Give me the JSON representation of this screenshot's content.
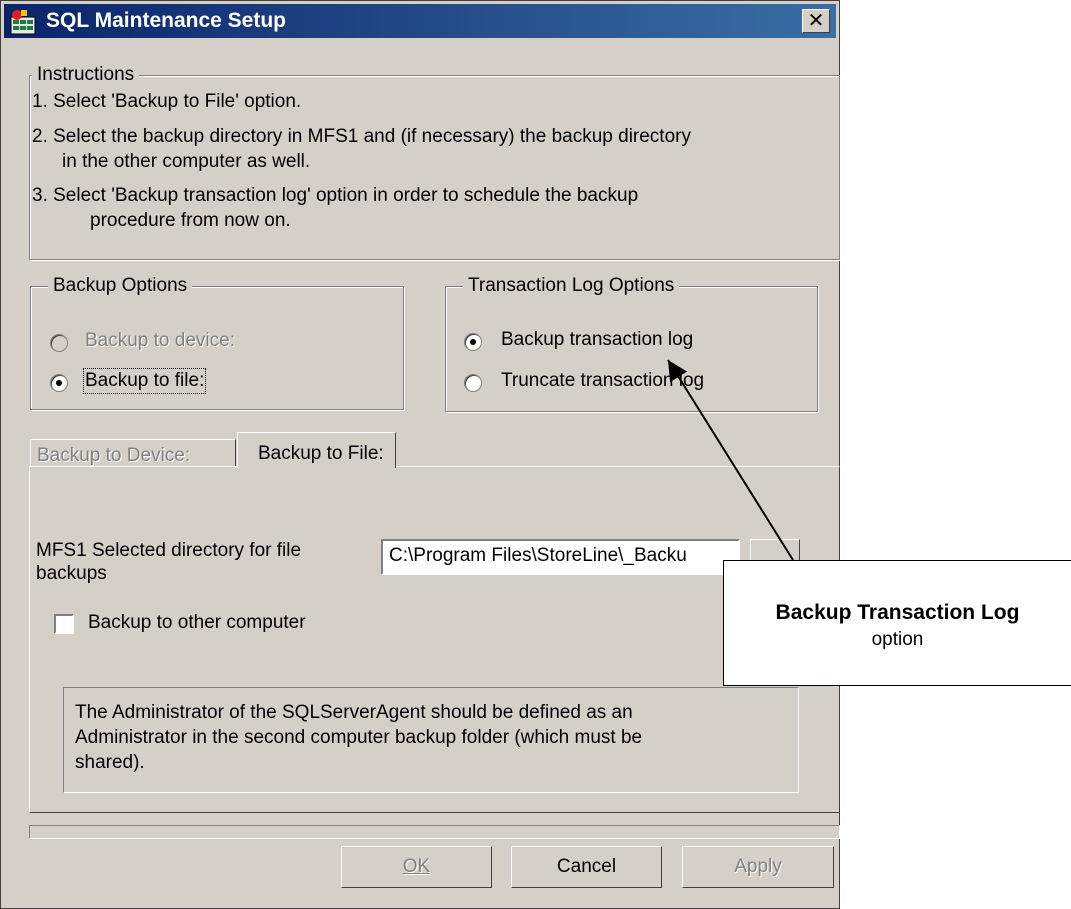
{
  "window": {
    "title": "SQL Maintenance Setup",
    "close_label": "✕"
  },
  "instructions": {
    "title": "Instructions",
    "steps": [
      "1. Select 'Backup to File' option.",
      "2. Select the backup directory in MFS1 and (if necessary) the backup directory",
      "in the other computer as well.",
      "3. Select 'Backup transaction log' option in order to schedule the backup",
      "procedure from now on."
    ]
  },
  "backup_options": {
    "title": "Backup Options",
    "device_label": "Backup to device:",
    "file_label": "Backup to file:",
    "selected": "file",
    "device_enabled": false
  },
  "log_options": {
    "title": "Transaction Log Options",
    "backup_label": "Backup transaction log",
    "truncate_label": "Truncate transaction log",
    "selected": "backup"
  },
  "tabs": [
    {
      "label": "Backup to Device:",
      "active": false,
      "enabled": false
    },
    {
      "label": "Backup to File:",
      "active": true,
      "enabled": true
    }
  ],
  "file_tab": {
    "dir_label_line1": "MFS1 Selected directory for file",
    "dir_label_line2": "backups",
    "dir_value": "C:\\Program Files\\StoreLine\\_Backu",
    "other_computer_label": "Backup to other computer",
    "other_computer_checked": false,
    "note_lines": [
      "The Administrator of the SQLServerAgent should be defined as an",
      "Administrator in the second computer backup folder (which must be",
      "shared)."
    ]
  },
  "buttons": {
    "ok": {
      "label": "OK",
      "enabled": false
    },
    "cancel": {
      "label": "Cancel",
      "enabled": true
    },
    "apply": {
      "label": "Apply",
      "enabled": false
    }
  },
  "callout": {
    "title": "Backup Transaction Log",
    "subtitle": "option"
  },
  "colors": {
    "titlebar": "#0a246a",
    "face": "#d4d0c8",
    "disabled_text": "#808080"
  }
}
